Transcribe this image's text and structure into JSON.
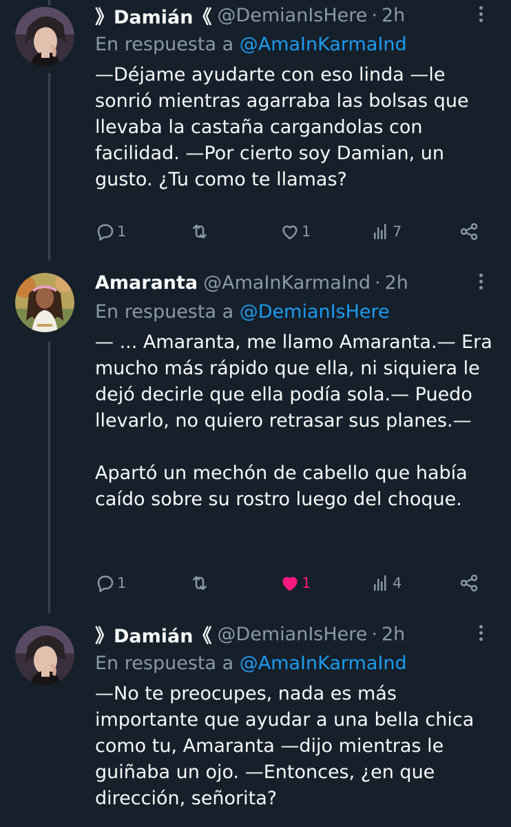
{
  "colors": {
    "background": "#15202b",
    "text": "#f7f9f9",
    "muted": "#8b98a5",
    "link": "#1d9bf0",
    "like_active": "#f91880",
    "thread_line": "#38444d"
  },
  "tweets": [
    {
      "name": "》Damián《",
      "handle": "@DemianIsHere",
      "time": "2h",
      "reply_prefix": "En respuesta a",
      "reply_mention": "@AmaInKarmaInd",
      "paragraphs": [
        "—Déjame ayudarte con eso linda —le sonrió mientras agarraba las bolsas que llevaba la castaña cargandolas con facilidad. —Por cierto soy Damian, un gusto. ¿Tu como te llamas?"
      ],
      "replies": "1",
      "retweets": "",
      "likes": "1",
      "liked": false,
      "views": "7"
    },
    {
      "name": "Amaranta",
      "handle": "@AmaInKarmaInd",
      "time": "2h",
      "reply_prefix": "En respuesta a",
      "reply_mention": "@DemianIsHere",
      "paragraphs": [
        "— ... Amaranta, me llamo Amaranta.— Era mucho más rápido que ella, ni siquiera le dejó decirle que ella podía sola.— Puedo llevarlo, no quiero retrasar sus planes.—",
        "Apartó un mechón de cabello que había caído sobre su rostro luego del choque."
      ],
      "replies": "1",
      "retweets": "",
      "likes": "1",
      "liked": true,
      "views": "4"
    },
    {
      "name": "》Damián《",
      "handle": "@DemianIsHere",
      "time": "2h",
      "reply_prefix": "En respuesta a",
      "reply_mention": "@AmaInKarmaInd",
      "paragraphs": [
        "—No te preocupes, nada es más importante que ayudar a una bella chica como tu, Amaranta —dijo mientras le guiñaba un ojo. —Entonces, ¿en que dirección, señorita?"
      ]
    }
  ],
  "separator": "·"
}
